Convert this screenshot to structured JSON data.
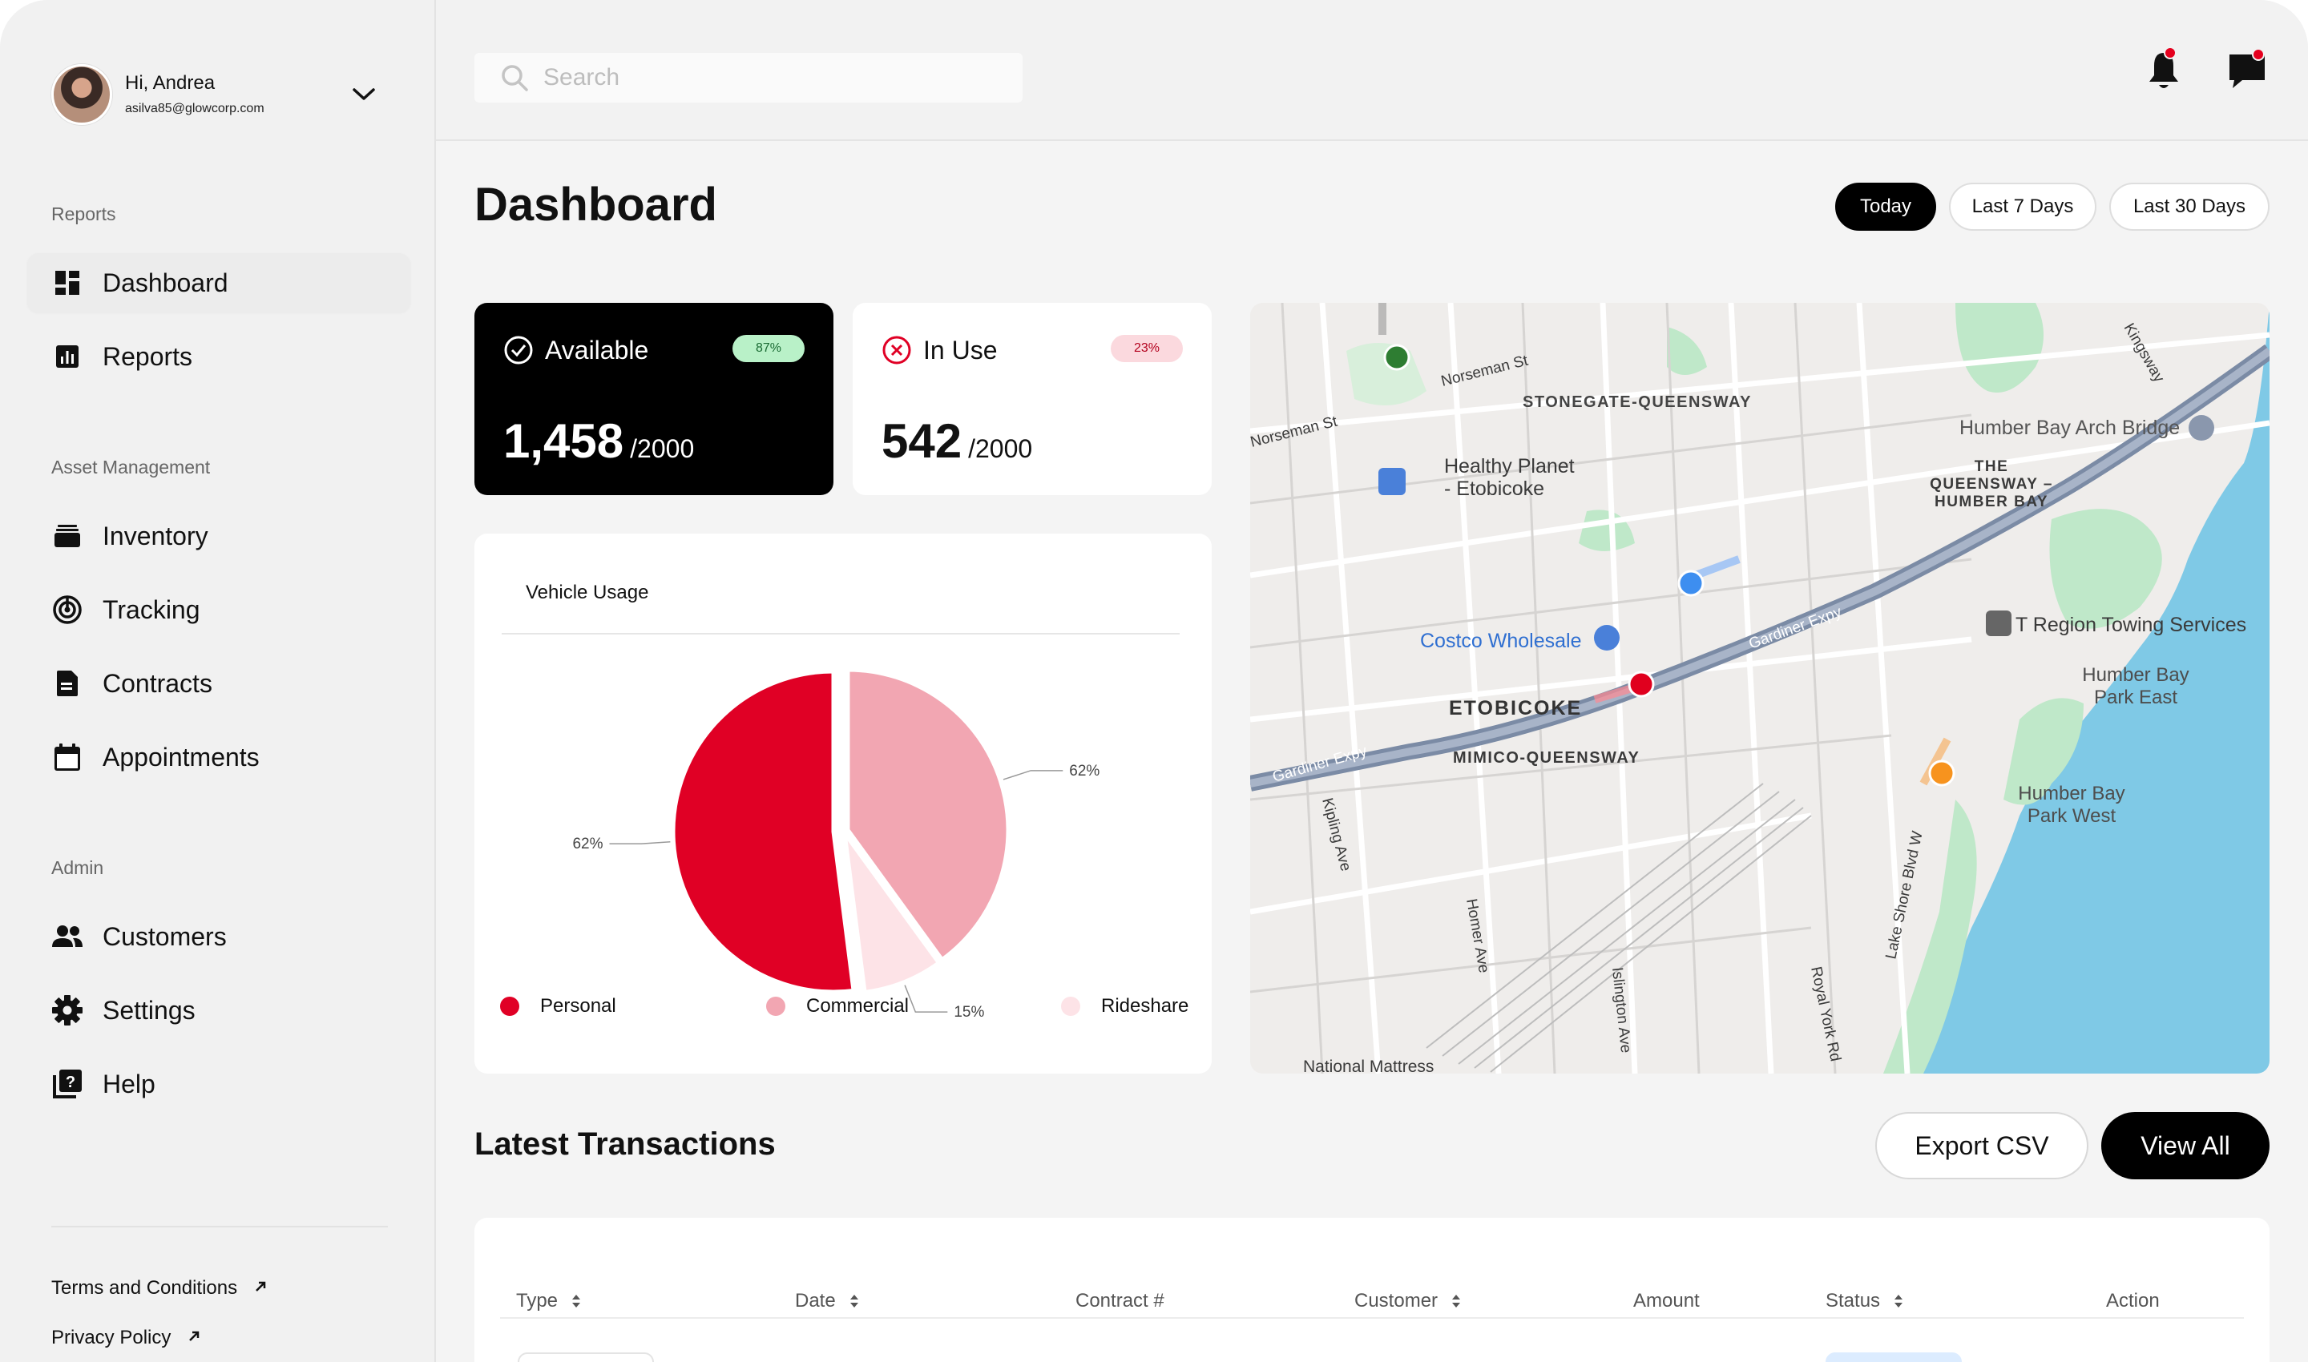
{
  "user": {
    "greeting": "Hi, Andrea",
    "email": "asilva85@glowcorp.com"
  },
  "sidebar": {
    "sections": [
      {
        "label": "Reports",
        "items": [
          {
            "label": "Dashboard",
            "icon": "dashboard-icon",
            "active": true
          },
          {
            "label": "Reports",
            "icon": "chart-icon"
          }
        ]
      },
      {
        "label": "Asset Management",
        "items": [
          {
            "label": "Inventory",
            "icon": "inventory-icon"
          },
          {
            "label": "Tracking",
            "icon": "tracking-icon"
          },
          {
            "label": "Contracts",
            "icon": "document-icon"
          },
          {
            "label": "Appointments",
            "icon": "calendar-icon"
          }
        ]
      },
      {
        "label": "Admin",
        "items": [
          {
            "label": "Customers",
            "icon": "users-icon"
          },
          {
            "label": "Settings",
            "icon": "gear-icon"
          },
          {
            "label": "Help",
            "icon": "help-icon"
          }
        ]
      }
    ],
    "footer": [
      {
        "label": "Terms and Conditions"
      },
      {
        "label": "Privacy Policy"
      }
    ]
  },
  "search": {
    "placeholder": "Search"
  },
  "page": {
    "title": "Dashboard"
  },
  "filters": [
    {
      "label": "Today",
      "active": true
    },
    {
      "label": "Last 7 Days"
    },
    {
      "label": "Last 30 Days"
    }
  ],
  "stats": {
    "available": {
      "label": "Available",
      "badge": "87%",
      "value": "1,458",
      "total": "/2000"
    },
    "in_use": {
      "label": "In Use",
      "badge": "23%",
      "value": "542",
      "total": "/2000"
    }
  },
  "vehicle_usage": {
    "title": "Vehicle Usage"
  },
  "chart_data": {
    "type": "pie",
    "title": "Vehicle Usage",
    "slices": [
      {
        "name": "Personal",
        "value": 52,
        "label": "62%",
        "color": "#e00025"
      },
      {
        "name": "Commercial",
        "value": 40,
        "label": "62%",
        "color": "#f2a6b2"
      },
      {
        "name": "Rideshare",
        "value": 8,
        "label": "15%",
        "color": "#fde3e7"
      }
    ],
    "legend": [
      "Personal",
      "Commercial",
      "Rideshare"
    ],
    "legend_position": "bottom"
  },
  "map": {
    "labels": {
      "norseman1": "Norseman St",
      "norseman2": "Norseman St",
      "stonegate": "STONEGATE-QUEENSWAY",
      "healthy1": "Healthy Planet",
      "healthy2": "- Etobicoke",
      "humberArch": "Humber Bay Arch Bridge",
      "queensway1": "THE",
      "queensway2": "QUEENSWAY –",
      "queensway3": "HUMBER BAY",
      "costco": "Costco Wholesale",
      "gardiner1": "Gardiner Expy",
      "gardiner2": "Gardiner Expy",
      "etobicoke": "ETOBICOKE",
      "mimico": "MIMICO-QUEENSWAY",
      "towing": "T Region Towing Services",
      "hbpe1": "Humber Bay",
      "hbpe2": "Park East",
      "hbpw1": "Humber Bay",
      "hbpw2": "Park West",
      "kipling": "Kipling Ave",
      "homer": "Homer Ave",
      "islington": "Islington Ave",
      "royalyork": "Royal York Rd",
      "lakeshore": "Lake Shore Blvd W",
      "kingsway": "Kingsway",
      "mattress": "National Mattress"
    },
    "vehicle_colors": [
      "#2e7d32",
      "#3d8ef0",
      "#e0001e",
      "#f7931e"
    ]
  },
  "transactions": {
    "title": "Latest Transactions",
    "export_label": "Export CSV",
    "view_all_label": "View All",
    "columns": [
      "Type",
      "Date",
      "Contract #",
      "Customer",
      "Amount",
      "Status",
      "Action"
    ]
  }
}
